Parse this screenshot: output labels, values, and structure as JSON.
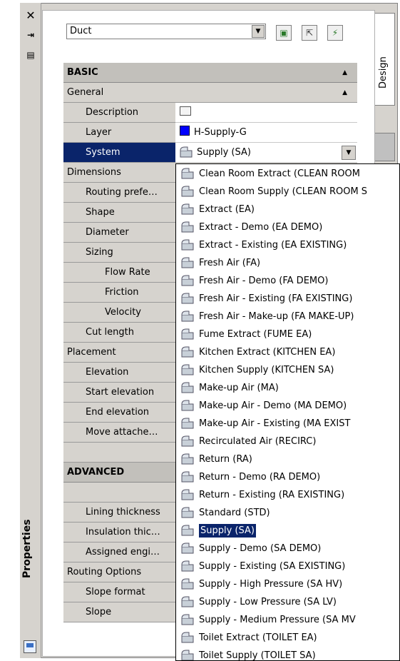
{
  "palette": {
    "title": "Properties",
    "tab_label": "Design",
    "close_glyph": "✕",
    "style_select_value": "Duct"
  },
  "sections": {
    "basic": "BASIC",
    "general": "General",
    "dimensions": "Dimensions",
    "placement": "Placement",
    "advanced": "ADVANCED",
    "routing_options": "Routing Options"
  },
  "props": {
    "description": "Description",
    "layer": "Layer",
    "layer_value": "H-Supply-G",
    "system": "System",
    "system_value": "Supply (SA)",
    "routing_pref": "Routing prefe…",
    "shape": "Shape",
    "diameter": "Diameter",
    "sizing": "Sizing",
    "flow_rate": "Flow Rate",
    "friction": "Friction",
    "velocity": "Velocity",
    "cut_length": "Cut length",
    "elevation": "Elevation",
    "start_elevation": "Start elevation",
    "end_elevation": "End elevation",
    "move_attached": "Move attache…",
    "lining_thickness": "Lining thickness",
    "insulation_thickness": "Insulation thic…",
    "assigned_engineering": "Assigned engi…",
    "slope_format": "Slope format",
    "slope": "Slope"
  },
  "system_options": [
    "Clean Room Extract (CLEAN ROOM",
    "Clean Room Supply (CLEAN ROOM S",
    "Extract (EA)",
    "Extract - Demo (EA DEMO)",
    "Extract - Existing (EA EXISTING)",
    "Fresh Air (FA)",
    "Fresh Air - Demo (FA DEMO)",
    "Fresh Air - Existing (FA EXISTING)",
    "Fresh Air - Make-up (FA MAKE-UP)",
    "Fume Extract (FUME EA)",
    "Kitchen Extract (KITCHEN EA)",
    "Kitchen Supply (KITCHEN SA)",
    "Make-up Air (MA)",
    "Make-up Air - Demo (MA DEMO)",
    "Make-up Air - Existing (MA EXIST",
    "Recirculated Air (RECIRC)",
    "Return (RA)",
    "Return - Demo (RA DEMO)",
    "Return - Existing (RA EXISTING)",
    "Standard (STD)",
    "Supply (SA)",
    "Supply - Demo (SA DEMO)",
    "Supply - Existing (SA EXISTING)",
    "Supply - High Pressure (SA HV)",
    "Supply - Low Pressure (SA LV)",
    "Supply - Medium Pressure (SA MV",
    "Toilet Extract (TOILET EA)",
    "Toilet Supply (TOILET SA)"
  ],
  "selected_option_index": 20,
  "colors": {
    "layer_swatch": "#0000ff",
    "selection": "#0a246a"
  }
}
